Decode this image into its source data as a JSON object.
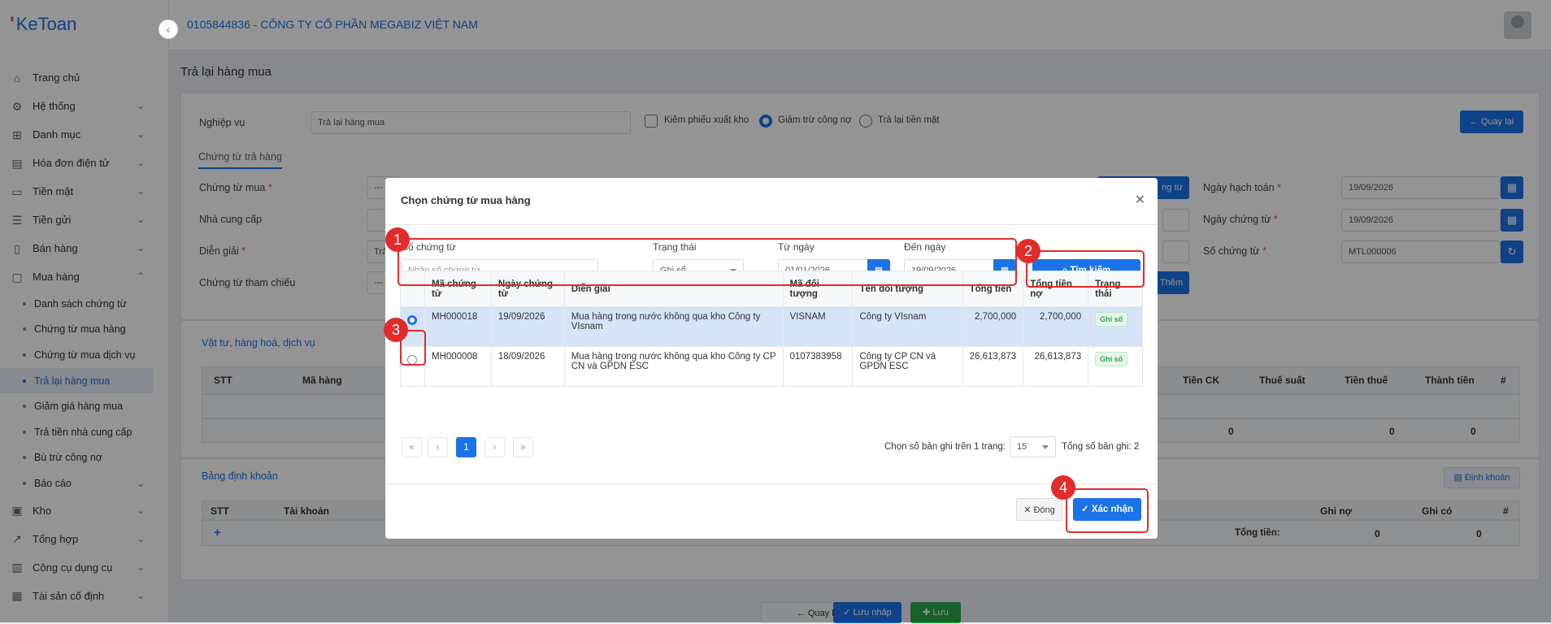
{
  "app": {
    "logo": "KeToan",
    "company": "0105844836 - CÔNG TY CỔ PHẦN MEGABIZ VIỆT NAM"
  },
  "sidebar": {
    "items": [
      {
        "label": "Trang chủ",
        "icon": "home-icon",
        "glyph": "⌂"
      },
      {
        "label": "Hệ thống",
        "icon": "gear-icon",
        "glyph": "⚙"
      },
      {
        "label": "Danh mục",
        "icon": "grid-icon",
        "glyph": "⊞"
      },
      {
        "label": "Hóa đơn điện tử",
        "icon": "invoice-icon",
        "glyph": "▤"
      },
      {
        "label": "Tiền mặt",
        "icon": "cash-icon",
        "glyph": "▭"
      },
      {
        "label": "Tiền gửi",
        "icon": "bank-icon",
        "glyph": "☰"
      },
      {
        "label": "Bán hàng",
        "icon": "sales-icon",
        "glyph": "▯"
      },
      {
        "label": "Mua hàng",
        "icon": "purchase-icon",
        "glyph": "▢"
      }
    ],
    "sub_items": [
      "Danh sách chứng từ",
      "Chứng từ mua hàng",
      "Chứng từ mua dịch vụ",
      "Trả lại hàng mua",
      "Giảm giá hàng mua",
      "Trả tiền nhà cung cấp",
      "Bù trừ công nợ",
      "Báo cáo"
    ],
    "items_after": [
      {
        "label": "Kho",
        "icon": "warehouse-icon",
        "glyph": "▣"
      },
      {
        "label": "Tổng hợp",
        "icon": "chart-icon",
        "glyph": "↗"
      },
      {
        "label": "Công cụ dụng cụ",
        "icon": "tools-icon",
        "glyph": "▥"
      },
      {
        "label": "Tài sản cố định",
        "icon": "asset-icon",
        "glyph": "▦"
      }
    ]
  },
  "page": {
    "title": "Trả lại hàng mua"
  },
  "form": {
    "nghiep_vu_label": "Nghiệp vụ",
    "nghiep_vu_value": "Trả lại hàng mua",
    "kiem_phieu": "Kiêm phiếu xuất kho",
    "giam_tru": "Giảm trừ công nợ",
    "tra_lai_tien": "Trả lại tiền mặt",
    "quay_lai": "Quay lại",
    "tab": "Chứng từ trả hàng",
    "chung_tu_mua": "Chứng từ mua",
    "nha_cung_cap": "Nhà cung cấp",
    "dien_giai": "Diễn giải",
    "dien_giai_stub": "Trả",
    "chung_tu_tham_chieu": "Chứng từ tham chiếu",
    "dash": "---",
    "chon_chung_tu_stub": "ng từ",
    "them": "Thêm",
    "ngay_hach_toan": "Ngày hạch toán",
    "ngay_hach_toan_value": "19/09/2026",
    "ngay_chung_tu": "Ngày chứng từ",
    "ngay_chung_tu_value": "19/09/2026",
    "so_chung_tu": "Số chứng từ",
    "so_chung_tu_value": "MTL000006",
    "required": "*"
  },
  "goods": {
    "title": "Vật tư, hàng hoá, dịch vụ",
    "headers": [
      "STT",
      "Mã hàng",
      "Tiền CK",
      "Thuế suất",
      "Tiền thuế",
      "Thành tiền",
      "#"
    ],
    "totals": [
      "0",
      "0",
      "0"
    ]
  },
  "accounting": {
    "title": "Bảng định khoản",
    "button": "Định khoản",
    "headers": [
      "STT",
      "Tài khoản",
      "Ghi nợ",
      "Ghi có",
      "#"
    ],
    "total_label": "Tổng tiền:",
    "totals": [
      "0",
      "0"
    ],
    "add": "+"
  },
  "footer": {
    "back": "Quay lại",
    "draft": "Lưu nháp",
    "save": "Lưu"
  },
  "modal": {
    "title": "Chọn chứng từ mua hàng",
    "so_chung_tu_label": "Số chứng từ",
    "so_chung_tu_placeholder": "Nhập số chứng từ...",
    "trang_thai_label": "Trạng thái",
    "trang_thai_value": "Ghi sổ",
    "tu_ngay_label": "Từ ngày",
    "tu_ngay_value": "01/01/2026",
    "den_ngay_label": "Đến ngày",
    "den_ngay_value": "19/09/2026",
    "search_button": "Tìm kiếm",
    "headers": [
      "Mã chứng từ",
      "Ngày chứng từ",
      "Diễn giải",
      "Mã đối tượng",
      "Tên đối tượng",
      "Tổng tiền",
      "Tổng tiền nợ",
      "Trạng thái"
    ],
    "rows": [
      {
        "ma": "MH000018",
        "ngay": "19/09/2026",
        "dien_giai": "Mua hàng trong nước không qua kho Công ty VIsnam",
        "ma_dt": "VISNAM",
        "ten_dt": "Công ty VIsnam",
        "tong": "2,700,000",
        "no": "2,700,000",
        "status": "Ghi sổ",
        "selected": true
      },
      {
        "ma": "MH000008",
        "ngay": "18/09/2026",
        "dien_giai": "Mua hàng trong nước không qua kho Công ty CP CN và GPDN ESC",
        "ma_dt": "0107383958",
        "ten_dt": "Công ty CP CN và GPDN ESC",
        "tong": "26,613,873",
        "no": "26,613,873",
        "status": "Ghi sổ",
        "selected": false
      }
    ],
    "pagination": {
      "first": "«",
      "prev": "‹",
      "current": "1",
      "next": "›",
      "last": "»"
    },
    "page_size_label": "Chọn số bản ghi trên 1 trang:",
    "page_size": "15",
    "total_label": "Tổng số bản ghi:",
    "total": "2",
    "close_button": "Đóng",
    "confirm_button": "Xác nhận"
  },
  "annotations": [
    "1",
    "2",
    "3",
    "4"
  ],
  "colors": {
    "accent": "#1a73e8",
    "annotation": "#e12c2c",
    "success": "#2aa84a"
  }
}
